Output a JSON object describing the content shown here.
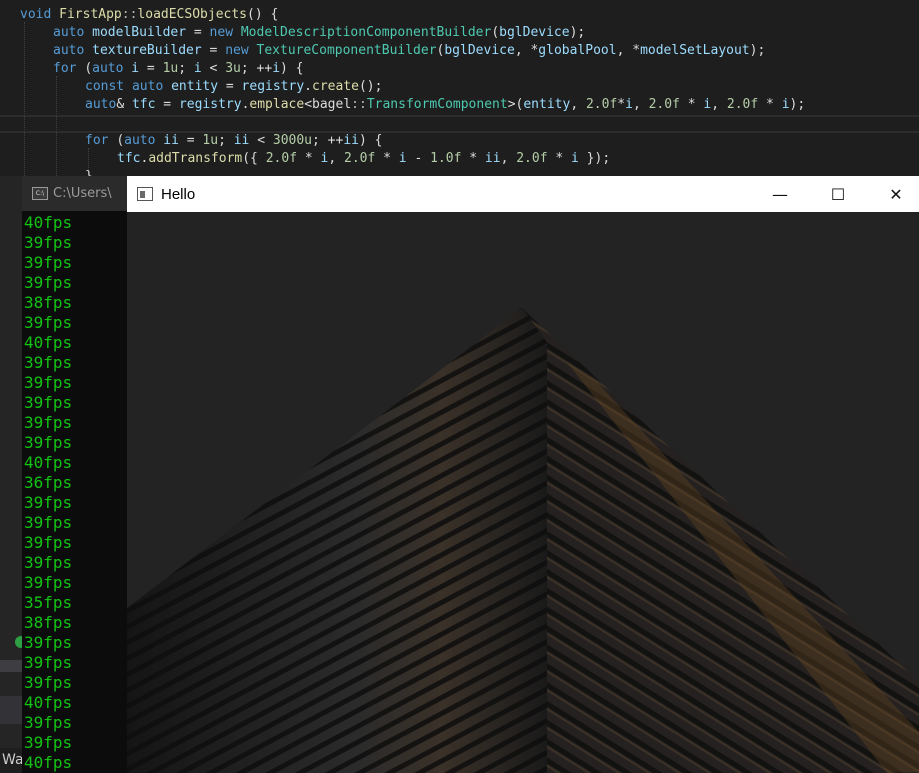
{
  "editor": {
    "lines": [
      [
        [
          "kw",
          "void "
        ],
        [
          "fn",
          "FirstApp"
        ],
        [
          "op",
          "::"
        ],
        [
          "fn",
          "loadECSObjects"
        ],
        [
          "pl",
          "() {"
        ]
      ],
      [
        [
          "kw",
          "auto "
        ],
        [
          "var",
          "modelBuilder"
        ],
        [
          "pl",
          " = "
        ],
        [
          "kw",
          "new "
        ],
        [
          "ty",
          "ModelDescriptionComponentBuilder"
        ],
        [
          "pl",
          "("
        ],
        [
          "var",
          "bglDevice"
        ],
        [
          "pl",
          ");"
        ]
      ],
      [
        [
          "kw",
          "auto "
        ],
        [
          "var",
          "textureBuilder"
        ],
        [
          "pl",
          " = "
        ],
        [
          "kw",
          "new "
        ],
        [
          "ty",
          "TextureComponentBuilder"
        ],
        [
          "pl",
          "("
        ],
        [
          "var",
          "bglDevice"
        ],
        [
          "pl",
          ", *"
        ],
        [
          "var",
          "globalPool"
        ],
        [
          "pl",
          ", *"
        ],
        [
          "var",
          "modelSetLayout"
        ],
        [
          "pl",
          ");"
        ]
      ],
      [
        [
          "kw",
          "for "
        ],
        [
          "pl",
          "("
        ],
        [
          "kw",
          "auto "
        ],
        [
          "var",
          "i"
        ],
        [
          "pl",
          " = "
        ],
        [
          "num",
          "1u"
        ],
        [
          "pl",
          "; "
        ],
        [
          "var",
          "i"
        ],
        [
          "pl",
          " < "
        ],
        [
          "num",
          "3u"
        ],
        [
          "pl",
          "; ++"
        ],
        [
          "var",
          "i"
        ],
        [
          "pl",
          ") {"
        ]
      ],
      [
        [
          "kw",
          "const auto "
        ],
        [
          "var",
          "entity"
        ],
        [
          "pl",
          " = "
        ],
        [
          "var",
          "registry"
        ],
        [
          "pl",
          "."
        ],
        [
          "fn",
          "create"
        ],
        [
          "pl",
          "();"
        ]
      ],
      [
        [
          "kw",
          "auto"
        ],
        [
          "pl",
          "& "
        ],
        [
          "var",
          "tfc"
        ],
        [
          "pl",
          " = "
        ],
        [
          "var",
          "registry"
        ],
        [
          "pl",
          "."
        ],
        [
          "fn",
          "emplace"
        ],
        [
          "pl",
          "<"
        ],
        [
          "pl",
          "bagel"
        ],
        [
          "op",
          "::"
        ],
        [
          "ty",
          "TransformComponent"
        ],
        [
          "pl",
          ">("
        ],
        [
          "var",
          "entity"
        ],
        [
          "pl",
          ", "
        ],
        [
          "num",
          "2.0f"
        ],
        [
          "pl",
          "*"
        ],
        [
          "var",
          "i"
        ],
        [
          "pl",
          ", "
        ],
        [
          "num",
          "2.0f"
        ],
        [
          "pl",
          " * "
        ],
        [
          "var",
          "i"
        ],
        [
          "pl",
          ", "
        ],
        [
          "num",
          "2.0f"
        ],
        [
          "pl",
          " * "
        ],
        [
          "var",
          "i"
        ],
        [
          "pl",
          ");"
        ]
      ],
      [],
      [
        [
          "kw",
          "for "
        ],
        [
          "pl",
          "("
        ],
        [
          "kw",
          "auto "
        ],
        [
          "var",
          "ii"
        ],
        [
          "pl",
          " = "
        ],
        [
          "num",
          "1u"
        ],
        [
          "pl",
          "; "
        ],
        [
          "var",
          "ii"
        ],
        [
          "pl",
          " < "
        ],
        [
          "num",
          "3000u"
        ],
        [
          "pl",
          "; ++"
        ],
        [
          "var",
          "ii"
        ],
        [
          "pl",
          ") {"
        ]
      ],
      [
        [
          "var",
          "tfc"
        ],
        [
          "pl",
          "."
        ],
        [
          "fn",
          "addTransform"
        ],
        [
          "pl",
          "({ "
        ],
        [
          "num",
          "2.0f"
        ],
        [
          "pl",
          " * "
        ],
        [
          "var",
          "i"
        ],
        [
          "pl",
          ", "
        ],
        [
          "num",
          "2.0f"
        ],
        [
          "pl",
          " * "
        ],
        [
          "var",
          "i"
        ],
        [
          "pl",
          " - "
        ],
        [
          "num",
          "1.0f"
        ],
        [
          "pl",
          " * "
        ],
        [
          "var",
          "ii"
        ],
        [
          "pl",
          ", "
        ],
        [
          "num",
          "2.0f"
        ],
        [
          "pl",
          " * "
        ],
        [
          "var",
          "i"
        ],
        [
          "pl",
          " });"
        ]
      ],
      [
        [
          "pl",
          "}"
        ]
      ]
    ]
  },
  "console": {
    "title": "C:\\Users\\",
    "icon": "console-icon",
    "icon_label": "C:\\",
    "fps_lines": [
      "40fps",
      "39fps",
      "39fps",
      "39fps",
      "38fps",
      "39fps",
      "40fps",
      "39fps",
      "39fps",
      "39fps",
      "39fps",
      "39fps",
      "40fps",
      "36fps",
      "39fps",
      "39fps",
      "39fps",
      "39fps",
      "39fps",
      "35fps",
      "38fps",
      "39fps",
      "39fps",
      "39fps",
      "40fps",
      "39fps",
      "39fps",
      "40fps"
    ],
    "text_color": "#13c313"
  },
  "behind": {
    "status_text": "Wa"
  },
  "hello_window": {
    "title": "Hello",
    "minimize_label": "—",
    "maximize_label": "☐",
    "close_label": "✕"
  }
}
